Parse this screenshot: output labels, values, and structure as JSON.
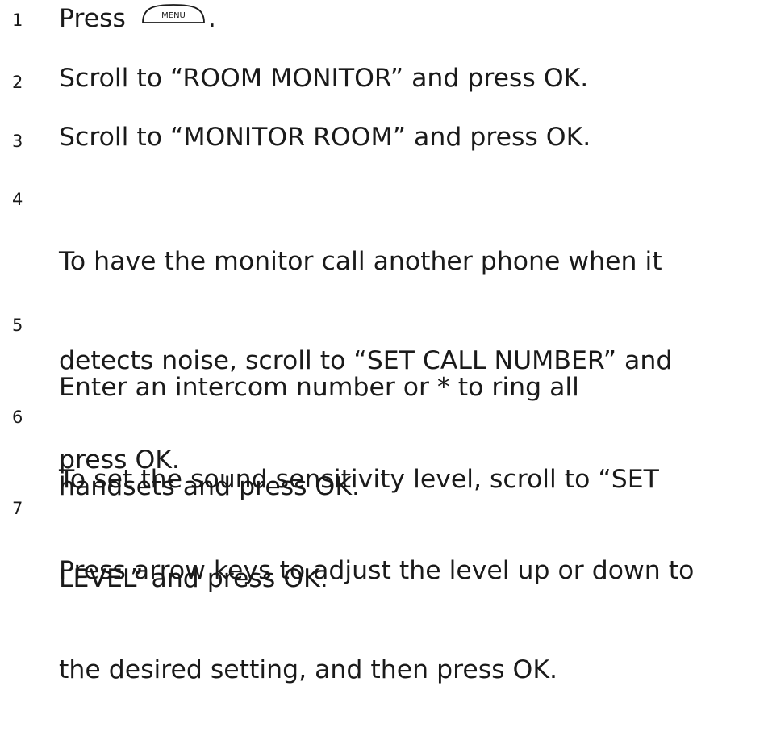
{
  "steps": [
    {
      "number": "1",
      "text_before": "Press ",
      "key_label": "MENU",
      "text_after": "."
    },
    {
      "number": "2",
      "text": "Scroll to “ROOM MONITOR” and press OK."
    },
    {
      "number": "3",
      "text": "Scroll to “MONITOR ROOM” and press OK."
    },
    {
      "number": "4",
      "lines": [
        "To have the monitor call another phone when it",
        "detects noise, scroll to “SET CALL NUMBER” and",
        "press OK."
      ]
    },
    {
      "number": "5",
      "lines": [
        "Enter an intercom number or * to ring all",
        "handsets and press OK."
      ]
    },
    {
      "number": "6",
      "lines": [
        "To set the sound sensitivity level, scroll to “SET",
        "LEVEL” and press OK."
      ]
    },
    {
      "number": "7",
      "lines": [
        "Press arrow keys to adjust the level up or down to",
        "the desired setting, and then press OK."
      ]
    }
  ]
}
